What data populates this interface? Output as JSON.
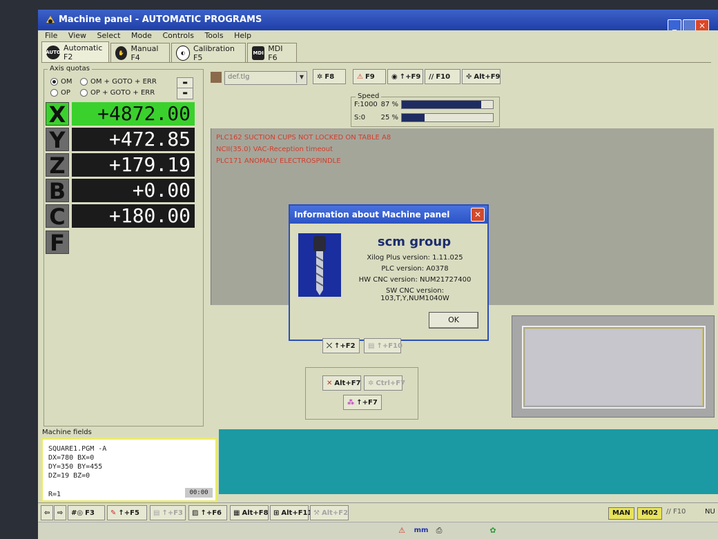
{
  "window": {
    "title": "Machine panel - AUTOMATIC PROGRAMS",
    "minimize": "_",
    "close": "×"
  },
  "menu": [
    "File",
    "View",
    "Select",
    "Mode",
    "Controls",
    "Tools",
    "Help"
  ],
  "tabs": [
    {
      "icon": "AUTO",
      "label": "Automatic F2"
    },
    {
      "icon": "✋",
      "label": "Manual F4"
    },
    {
      "icon": "◐",
      "label": "Calibration F5"
    },
    {
      "icon": "MDI",
      "label": "MDI F6"
    }
  ],
  "axis_panel": {
    "legend": "Axis quotas",
    "radio_om": "OM",
    "radio_om_goto": "OM + GOTO + ERR",
    "radio_op": "OP",
    "radio_op_goto": "OP + GOTO + ERR",
    "axes": [
      {
        "letter": "X",
        "value": "+4872.00"
      },
      {
        "letter": "Y",
        "value": "+472.85"
      },
      {
        "letter": "Z",
        "value": "+179.19"
      },
      {
        "letter": "B",
        "value": "+0.00"
      },
      {
        "letter": "C",
        "value": "+180.00"
      },
      {
        "letter": "F",
        "value": ""
      }
    ]
  },
  "toolbar": {
    "tlg_value": "def.tlg",
    "buttons": [
      "F8",
      "F9",
      "↑+F9",
      "F10",
      "Alt+F9"
    ]
  },
  "speed": {
    "legend": "Speed",
    "rows": [
      {
        "label": "F:1000",
        "pct": "87  %",
        "fraction": 0.87
      },
      {
        "label": "S:0",
        "pct": "25  %",
        "fraction": 0.25
      }
    ]
  },
  "messages": [
    "PLC162 SUCTION CUPS NOT LOCKED ON TABLE A8",
    "NCII(35.0) VAC-Reception timeout",
    "PLC171 ANOMALY ELECTROSPINDLE"
  ],
  "dialog": {
    "title": "Information about Machine panel",
    "logo": "scm group",
    "lines": [
      "Xilog Plus version: 1.11.025",
      "PLC version: A0378",
      "HW CNC version: NUM21727400",
      "SW CNC version: 103,T,Y,NUM1040W"
    ],
    "ok": "OK"
  },
  "mid_buttons": {
    "shift_f2": "↑+F2",
    "shift_f10": "↑+F10",
    "alt_f7": "Alt+F7",
    "ctrl_f7": "Ctrl+F7",
    "shift_f7": "↑+F7"
  },
  "machine_fields": {
    "label": "Machine fields",
    "lines": [
      "SQUARE1.PGM  -A",
      "DX=780 BX=0",
      "DY=350 BY=455",
      "DZ=19 BZ=0",
      "R=1"
    ],
    "time": "00:00"
  },
  "bottom_buttons": [
    "F3",
    "↑+F5",
    "↑+F3",
    "↑+F6",
    "Alt+F8",
    "Alt+F11",
    "Alt+F2"
  ],
  "status": {
    "man": "MAN",
    "m02": "M02",
    "f10": "F10",
    "nu": "NU"
  },
  "taskbar": {
    "mm": "mm"
  }
}
